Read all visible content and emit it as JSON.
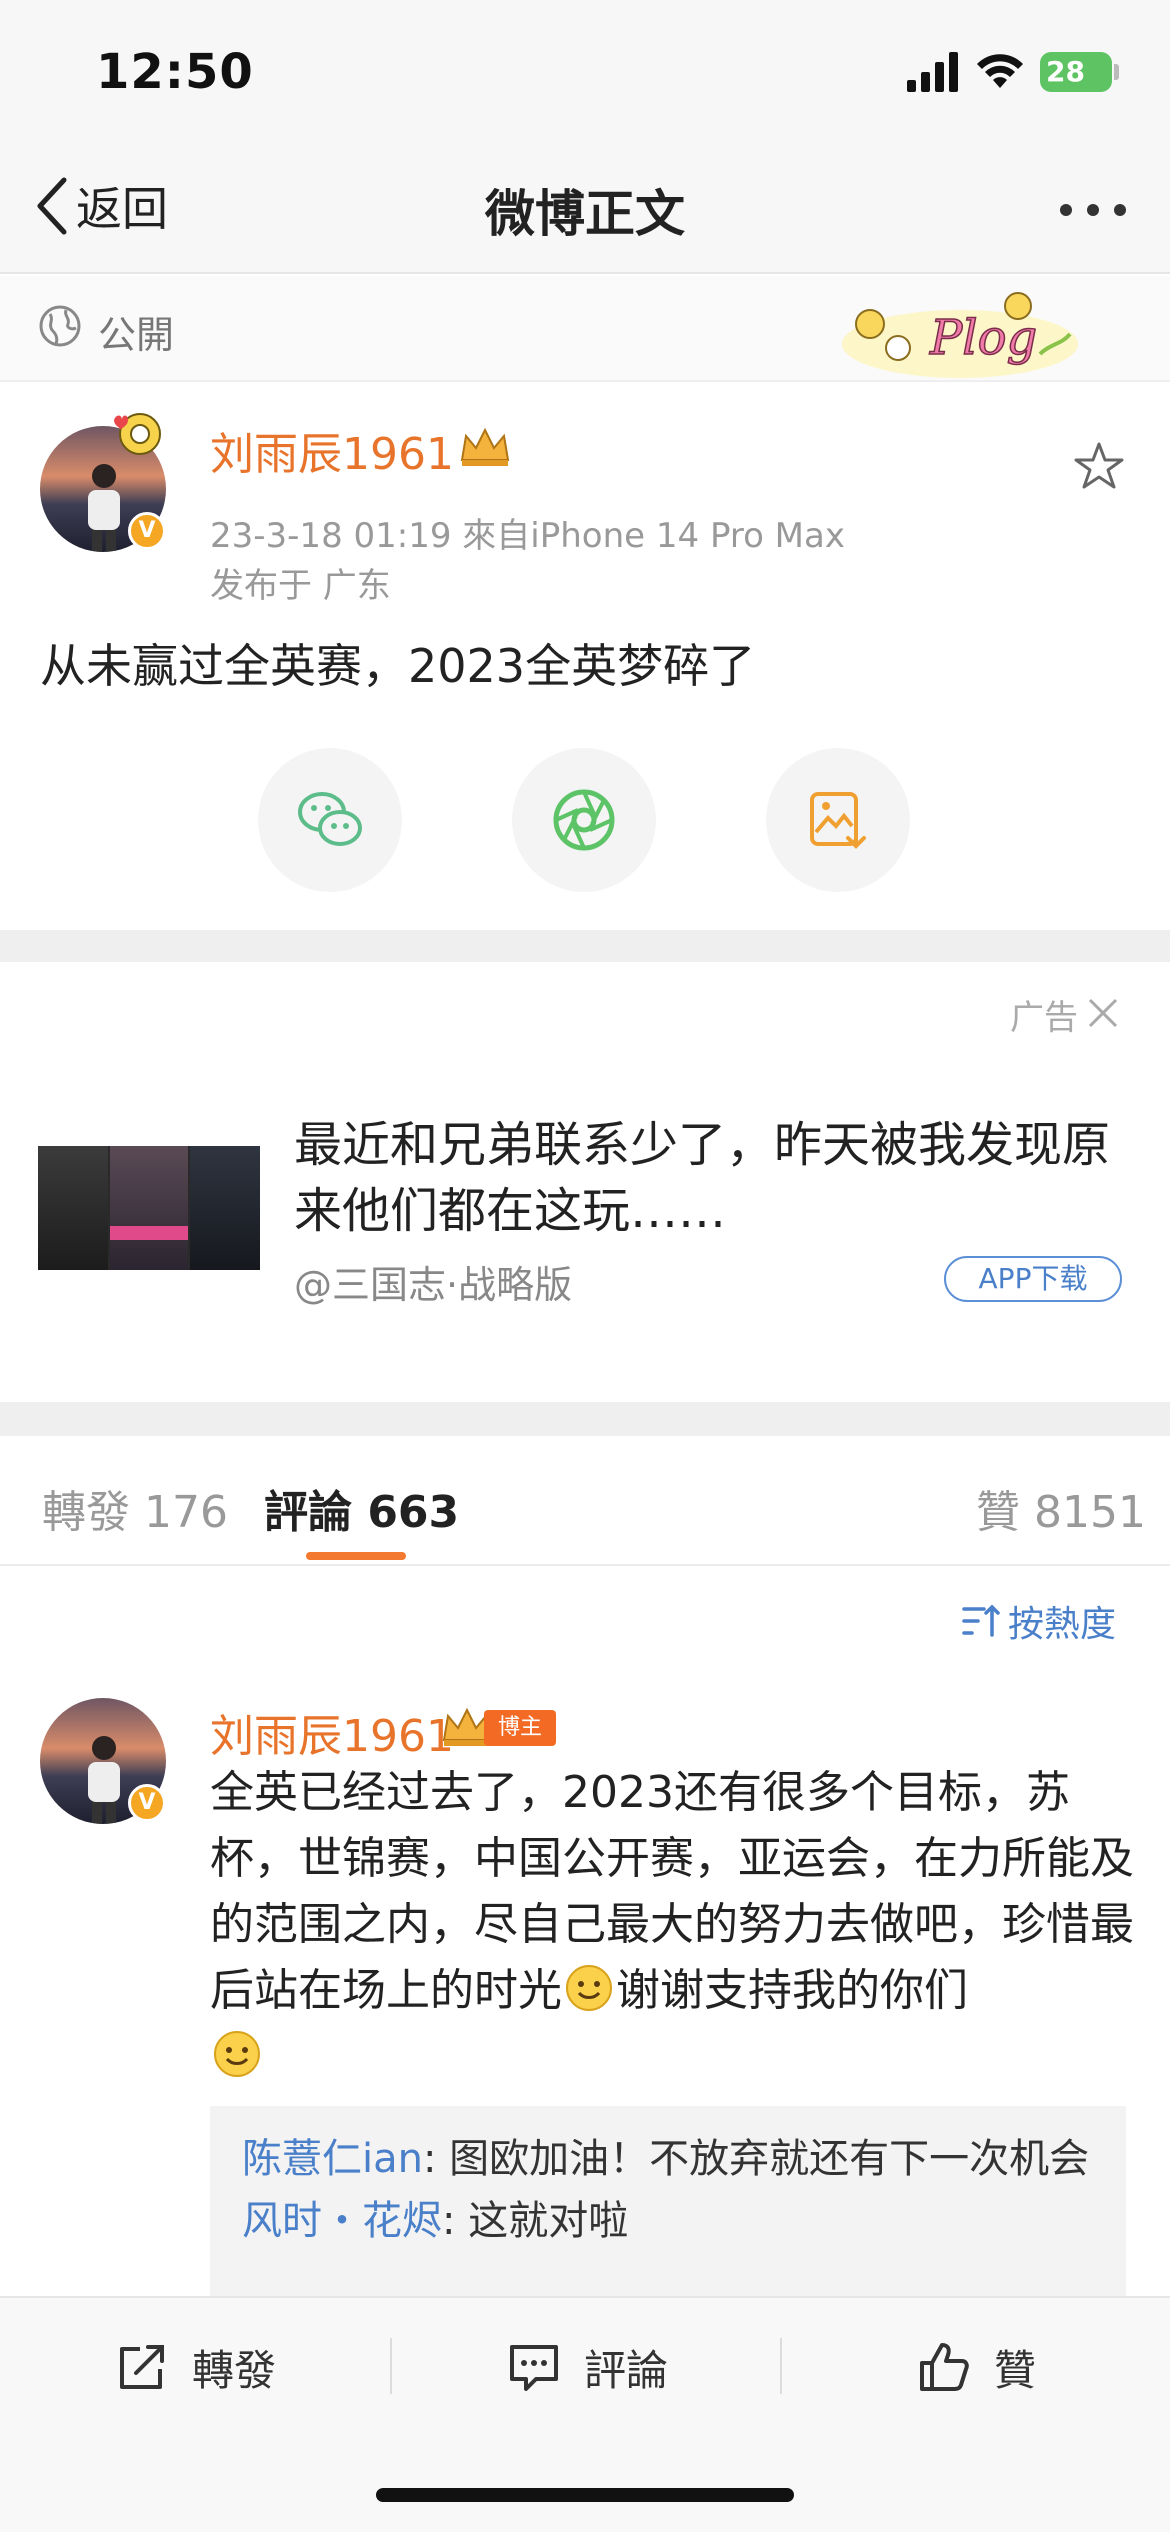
{
  "status_bar": {
    "time": "12:50",
    "battery": "28"
  },
  "nav": {
    "back_label": "返回",
    "title": "微博正文"
  },
  "visibility": {
    "label": "公開"
  },
  "post": {
    "username": "刘雨辰1961",
    "meta": "23-3-18 01:19  來自iPhone 14 Pro Max",
    "location": "发布于 广东",
    "text": "从未赢过全英赛，2023全英梦碎了",
    "verified_badge": "V"
  },
  "ad": {
    "label": "广告",
    "title": "最近和兄弟联系少了，昨天被我发现原来他们都在这玩……",
    "source": "@三国志·战略版",
    "button_label": "APP下载"
  },
  "tabs": [
    {
      "label": "轉發 176"
    },
    {
      "label": "評論 663"
    },
    {
      "label": "贊 8151"
    }
  ],
  "comments": {
    "sort_label": "按熱度",
    "items": [
      {
        "username": "刘雨辰1961",
        "host_tag": "博主",
        "text_part1": "全英已经过去了，2023还有很多个目标，苏杯，世锦赛，中国公开赛，亚运会，在力所能及的范围之内，尽自己最大的努力去做吧，珍惜最后站在场上的时光",
        "text_part2": "谢谢支持我的你们",
        "replies": [
          {
            "name": "陈薏仁ian",
            "text": ": 图欧加油！不放弃就还有下一次机会"
          },
          {
            "name": "风时・花烬",
            "text": ": 这就对啦"
          }
        ]
      }
    ]
  },
  "toolbar": {
    "repost_label": "轉發",
    "comment_label": "評論",
    "like_label": "贊"
  },
  "colors": {
    "accent_orange": "#e8742b",
    "link_blue": "#4a7fc9",
    "tab_underline": "#f2792f"
  }
}
